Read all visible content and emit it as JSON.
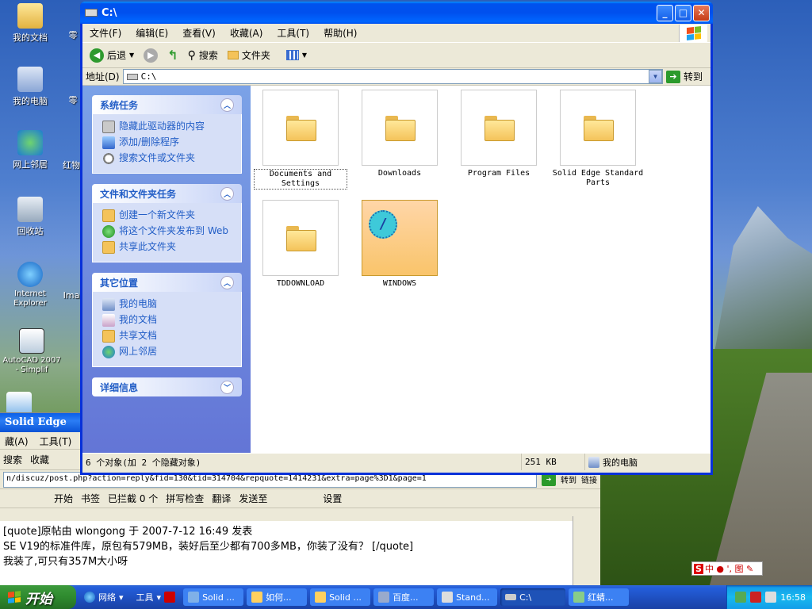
{
  "desktop": {
    "icons": [
      {
        "label": "我的文档",
        "icon": "my-documents-icon"
      },
      {
        "label": "我的电脑",
        "icon": "my-computer-icon"
      },
      {
        "label": "网上邻居",
        "icon": "network-places-icon"
      },
      {
        "label": "回收站",
        "icon": "recycle-bin-icon"
      },
      {
        "label": "Internet Explorer",
        "icon": "ie-icon"
      },
      {
        "label": "AutoCAD 2007 - Simplif",
        "icon": "autocad-icon"
      }
    ],
    "partial_labels": [
      "零",
      "零",
      "红物",
      "Ima"
    ]
  },
  "explorer": {
    "title": "C:\\",
    "menu": [
      "文件(F)",
      "编辑(E)",
      "查看(V)",
      "收藏(A)",
      "工具(T)",
      "帮助(H)"
    ],
    "toolbar": {
      "back": "后退",
      "search": "搜索",
      "folders": "文件夹"
    },
    "address": {
      "label": "地址(D)",
      "value": "C:\\",
      "go": "转到"
    },
    "panels": [
      {
        "title": "系统任务",
        "chevron": "︿",
        "items": [
          {
            "label": "隐藏此驱动器的内容",
            "icon": "hide-drive-icon"
          },
          {
            "label": "添加/删除程序",
            "icon": "add-remove-icon"
          },
          {
            "label": "搜索文件或文件夹",
            "icon": "search-icon"
          }
        ]
      },
      {
        "title": "文件和文件夹任务",
        "chevron": "︿",
        "items": [
          {
            "label": "创建一个新文件夹",
            "icon": "new-folder-icon"
          },
          {
            "label": "将这个文件夹发布到 Web",
            "icon": "publish-web-icon"
          },
          {
            "label": "共享此文件夹",
            "icon": "share-folder-icon"
          }
        ]
      },
      {
        "title": "其它位置",
        "chevron": "︿",
        "items": [
          {
            "label": "我的电脑",
            "icon": "my-computer-icon"
          },
          {
            "label": "我的文档",
            "icon": "my-documents-icon"
          },
          {
            "label": "共享文档",
            "icon": "shared-docs-icon"
          },
          {
            "label": "网上邻居",
            "icon": "network-places-icon"
          }
        ]
      },
      {
        "title": "详细信息",
        "chevron": "﹀",
        "items": []
      }
    ],
    "files": [
      {
        "name": "Documents and Settings",
        "selected": true
      },
      {
        "name": "Downloads"
      },
      {
        "name": "Program Files"
      },
      {
        "name": "Solid Edge Standard Parts"
      },
      {
        "name": "TDDOWNLOAD"
      },
      {
        "name": "WINDOWS",
        "special": true
      }
    ],
    "status": {
      "objects": "6 个对象(加 2 个隐藏对象)",
      "size": "251 KB",
      "location": "我的电脑"
    }
  },
  "background_window": {
    "title": "Solid Edge",
    "menu": [
      "藏(A)",
      "工具(T)"
    ],
    "toolbar": [
      "搜索",
      "收藏"
    ],
    "address": "n/discuz/post.php?action=reply&fid=130&tid=314704&repquote=1414231&extra=page%3D1&page=1",
    "go": "转到",
    "links": "链接",
    "toolbar2": [
      "开始",
      "书签",
      "已拦截 0 个",
      "拼写检查",
      "翻译",
      "发送至",
      "设置"
    ],
    "text_lines": [
      "[quote]原帖由 wlongong 于 2007-7-12 16:49 发表",
      "SE V19的标准件库，原包有579MB，装好后至少都有700多MB，你装了没有？ [/quote]",
      "我装了,可只有357M大小呀"
    ]
  },
  "taskbar": {
    "start": "开始",
    "quick": [
      "网络",
      "工具"
    ],
    "items": [
      {
        "label": "Solid ..."
      },
      {
        "label": "如何..."
      },
      {
        "label": "Solid ..."
      },
      {
        "label": "百度..."
      },
      {
        "label": "Stand..."
      },
      {
        "label": "C:\\",
        "active": true
      },
      {
        "label": "红蜻..."
      }
    ],
    "ime": "中 ● ', 图 ✎",
    "clock": "16:58"
  },
  "colors": {
    "title_blue": "#0053ee",
    "taskpane_blue": "#6375d6",
    "link_blue": "#215dc6",
    "start_green": "#2e8a2e",
    "folder_yellow": "#f4c35a"
  }
}
